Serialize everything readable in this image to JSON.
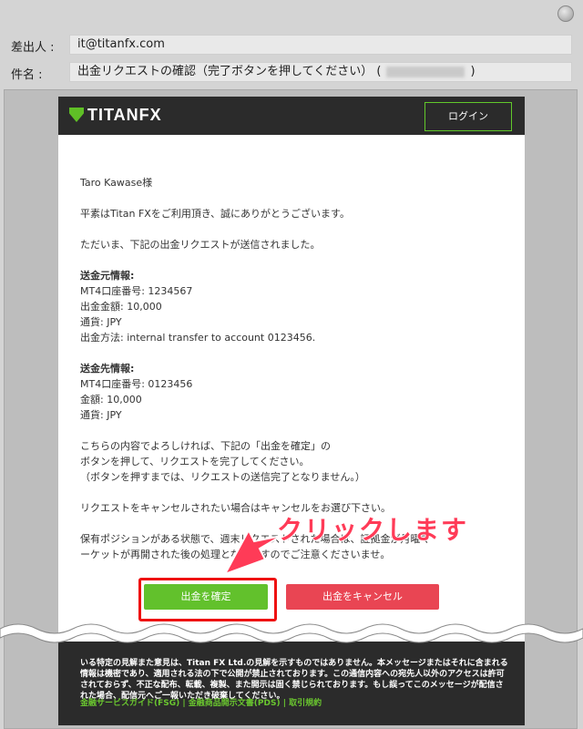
{
  "header": {
    "from_label": "差出人 :",
    "from_value": "it@titanfx.com",
    "subject_label": "件名 :",
    "subject_value": "出金リクエストの確認（完了ボタンを押してください） (",
    "subject_close": ")"
  },
  "mail": {
    "brand": "TITANFX",
    "login": "ログイン",
    "greeting": "Taro Kawase様",
    "thanks": "平素はTitan FXをご利用頂き、誠にありがとうございます。",
    "sent_msg": "ただいま、下記の出金リクエストが送信されました。",
    "source": {
      "title": "送金元情報:",
      "lines": [
        "MT4口座番号: 1234567",
        "出金金額: 10,000",
        "通貨: JPY",
        "出金方法: internal transfer to account 0123456."
      ]
    },
    "dest": {
      "title": "送金先情報:",
      "lines": [
        "MT4口座番号: 0123456",
        "金額: 10,000",
        "通貨: JPY"
      ]
    },
    "instructions": [
      "こちらの内容でよろしければ、下記の「出金を確定」の",
      "ボタンを押して、リクエストを完了してください。",
      "（ボタンを押すまでは、リクエストの送信完了となりません。）"
    ],
    "cancel_note": "リクエストをキャンセルされたい場合はキャンセルをお選び下さい。",
    "position_note": [
      "保有ポジションがある状態で、週末リクエストされた場合は、証拠金が月曜マ",
      "ーケットが再開された後の処理となりますのでご注意くださいませ。"
    ],
    "confirm_btn": "出金を確定",
    "cancel_btn": "出金をキャンセル",
    "footer_text": "いる特定の見解また意見は、Titan FX Ltd.の見解を示すものではありません。本メッセージまたはそれに含まれる情報は機密であり、適用される法の下で公開が禁止されております。この通信内容への宛先人以外のアクセスは許可されておらず、不正な配布、転載、複製、また開示は固く禁じられております。もし誤ってこのメッセージが配信された場合、配信元へご一報いただき破棄してください。",
    "footer_links": "金融サービスガイド(FSG) | 金融商品開示文書(PDS) | 取引規約"
  },
  "annotation": "クリックします"
}
